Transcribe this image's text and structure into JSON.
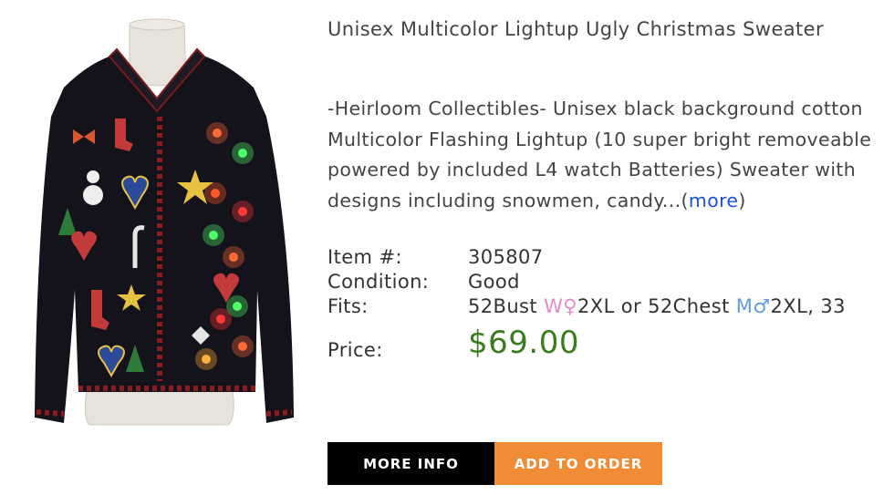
{
  "product": {
    "title": "Unisex Multicolor Lightup Ugly Christmas Sweater",
    "description_lines": [
      "-Heirloom Collectibles- Unisex black background cotton",
      "Multicolor Flashing Lightup (10 super bright removeable",
      "powered by included L4 watch Batteries) Sweater with",
      "designs including snowmen, candy..."
    ],
    "more_prefix": "(",
    "more_link": "more",
    "more_suffix": ")"
  },
  "specs": {
    "item_label": "Item #:",
    "item_value": "305807",
    "condition_label": "Condition:",
    "condition_value": "Good",
    "fits_label": "Fits:",
    "fits_part1": "52Bust ",
    "fits_women": "W♀",
    "fits_part2": "2XL or 52Chest ",
    "fits_men": "M♂",
    "fits_part3": "2XL, 33",
    "price_label": "Price:",
    "price_value": "$69.00"
  },
  "buttons": {
    "more_info": "MORE INFO",
    "add_to_order": "ADD TO ORDER"
  },
  "colors": {
    "price": "#3a7d1f",
    "link": "#1d4fe0",
    "women": "#e58acb",
    "men": "#5f9be6",
    "more_info_bg": "#000000",
    "add_to_order_bg": "#f08c35"
  },
  "image": {
    "subject": "black cardigan sweater on mannequin with Christmas appliques and colored lights"
  }
}
